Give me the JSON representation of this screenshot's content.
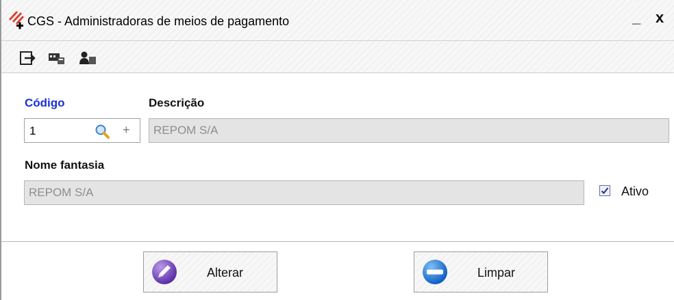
{
  "window": {
    "title": "CGS - Administradoras de meios de pagamento",
    "minimize_label": "_",
    "close_label": "x"
  },
  "toolbar": {
    "icons": [
      "exit-icon",
      "card-icon",
      "users-icon"
    ]
  },
  "form": {
    "codigo_label": "Código",
    "codigo_value": "1",
    "descricao_label": "Descrição",
    "descricao_value": "REPOM S/A",
    "nome_fantasia_label": "Nome fantasia",
    "nome_fantasia_value": "REPOM S/A",
    "ativo_label": "Ativo",
    "ativo_checked": true,
    "plus_glyph": "+"
  },
  "buttons": {
    "alterar": "Alterar",
    "limpar": "Limpar"
  },
  "colors": {
    "label_blue": "#1a2fd6",
    "alterar_icon": "#6b3fb8",
    "limpar_icon": "#1d73d6"
  }
}
